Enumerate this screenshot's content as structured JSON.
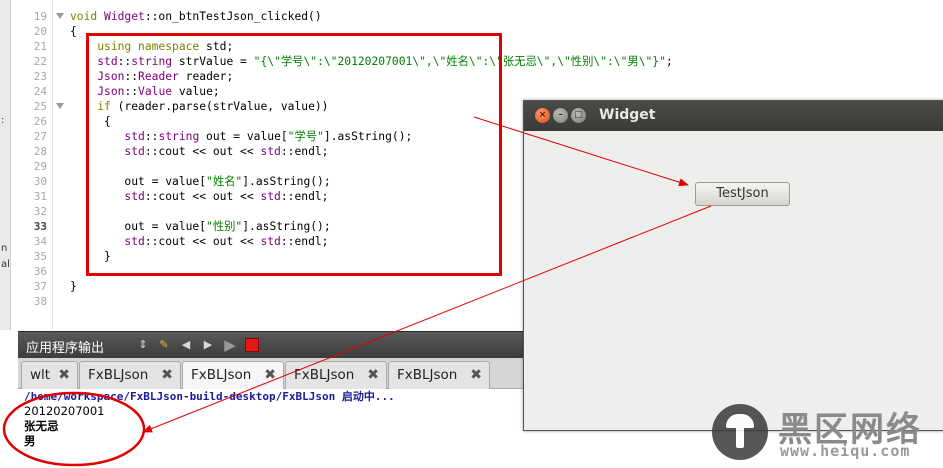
{
  "editor": {
    "edge_marks": [
      ":",
      "n",
      "al"
    ],
    "line_numbers": [
      "19",
      "20",
      "21",
      "22",
      "23",
      "24",
      "25",
      "26",
      "27",
      "28",
      "29",
      "30",
      "31",
      "32",
      "33",
      "34",
      "35",
      "36",
      "37",
      "38"
    ],
    "current_line": "33",
    "code": [
      [
        {
          "t": "void ",
          "c": "kw"
        },
        {
          "t": "Widget",
          "c": "ty"
        },
        {
          "t": "::on_btnTestJson_clicked()",
          "c": ""
        }
      ],
      [
        {
          "t": "{",
          "c": ""
        }
      ],
      [
        {
          "t": "    ",
          "c": ""
        },
        {
          "t": "using namespace",
          "c": "kw"
        },
        {
          "t": " std;",
          "c": ""
        }
      ],
      [
        {
          "t": "    ",
          "c": ""
        },
        {
          "t": "std",
          "c": "ty"
        },
        {
          "t": "::",
          "c": ""
        },
        {
          "t": "string",
          "c": "ty"
        },
        {
          "t": " strValue = ",
          "c": ""
        },
        {
          "t": "\"{\\\"学号\\\":\\\"20120207001\\\",\\\"姓名\\\":\\\"张无忌\\\",\\\"性别\\\":\\\"男\\\"}\"",
          "c": "str"
        },
        {
          "t": ";",
          "c": ""
        }
      ],
      [
        {
          "t": "    ",
          "c": ""
        },
        {
          "t": "Json",
          "c": "ty"
        },
        {
          "t": "::",
          "c": ""
        },
        {
          "t": "Reader",
          "c": "ty"
        },
        {
          "t": " reader;",
          "c": ""
        }
      ],
      [
        {
          "t": "    ",
          "c": ""
        },
        {
          "t": "Json",
          "c": "ty"
        },
        {
          "t": "::",
          "c": ""
        },
        {
          "t": "Value",
          "c": "ty"
        },
        {
          "t": " value;",
          "c": ""
        }
      ],
      [
        {
          "t": "    ",
          "c": ""
        },
        {
          "t": "if",
          "c": "kw"
        },
        {
          "t": " (reader.parse(strValue, value))",
          "c": ""
        }
      ],
      [
        {
          "t": "     {",
          "c": ""
        }
      ],
      [
        {
          "t": "        ",
          "c": ""
        },
        {
          "t": "std",
          "c": "ty"
        },
        {
          "t": "::",
          "c": ""
        },
        {
          "t": "string",
          "c": "ty"
        },
        {
          "t": " out = value[",
          "c": ""
        },
        {
          "t": "\"学号\"",
          "c": "str"
        },
        {
          "t": "].asString();",
          "c": ""
        }
      ],
      [
        {
          "t": "        ",
          "c": ""
        },
        {
          "t": "std",
          "c": "ty"
        },
        {
          "t": "::cout << out << ",
          "c": ""
        },
        {
          "t": "std",
          "c": "ty"
        },
        {
          "t": "::endl;",
          "c": ""
        }
      ],
      [
        {
          "t": "",
          "c": ""
        }
      ],
      [
        {
          "t": "        out = value[",
          "c": ""
        },
        {
          "t": "\"姓名\"",
          "c": "str"
        },
        {
          "t": "].asString();",
          "c": ""
        }
      ],
      [
        {
          "t": "        ",
          "c": ""
        },
        {
          "t": "std",
          "c": "ty"
        },
        {
          "t": "::cout << out << ",
          "c": ""
        },
        {
          "t": "std",
          "c": "ty"
        },
        {
          "t": "::endl;",
          "c": ""
        }
      ],
      [
        {
          "t": "",
          "c": ""
        }
      ],
      [
        {
          "t": "        out = value[",
          "c": ""
        },
        {
          "t": "\"性别\"",
          "c": "str"
        },
        {
          "t": "].asString();",
          "c": ""
        }
      ],
      [
        {
          "t": "        ",
          "c": ""
        },
        {
          "t": "std",
          "c": "ty"
        },
        {
          "t": "::cout << out << ",
          "c": ""
        },
        {
          "t": "std",
          "c": "ty"
        },
        {
          "t": "::endl;",
          "c": ""
        }
      ],
      [
        {
          "t": "     }",
          "c": ""
        }
      ],
      [
        {
          "t": "",
          "c": ""
        }
      ],
      [
        {
          "t": "}",
          "c": ""
        }
      ],
      [
        {
          "t": "",
          "c": ""
        }
      ]
    ]
  },
  "output_panel": {
    "title": "应用程序输出",
    "icons": [
      "sort-arrows-icon",
      "clear-output-icon",
      "prev-arrow-icon",
      "next-arrow-icon",
      "run-icon",
      "stop-icon"
    ],
    "tabs": [
      {
        "label": "wlt",
        "active": false
      },
      {
        "label": "FxBLJson",
        "active": false
      },
      {
        "label": "FxBLJson",
        "active": true
      },
      {
        "label": "FxBLJson",
        "active": false
      },
      {
        "label": "FxBLJson",
        "active": false
      }
    ],
    "lines": [
      "/home/workspace/FxBLJson-build-desktop/FxBLJson 启动中...",
      "20120207001",
      "张无忌",
      "男"
    ]
  },
  "widget_window": {
    "title": "Widget",
    "button_label": "TestJson"
  },
  "watermark": {
    "text": "黑区网络",
    "url": "www.heiqu.com"
  },
  "colors": {
    "annotation_red": "#e00000",
    "keyword": "#808000",
    "type": "#800080",
    "string": "#008000"
  }
}
